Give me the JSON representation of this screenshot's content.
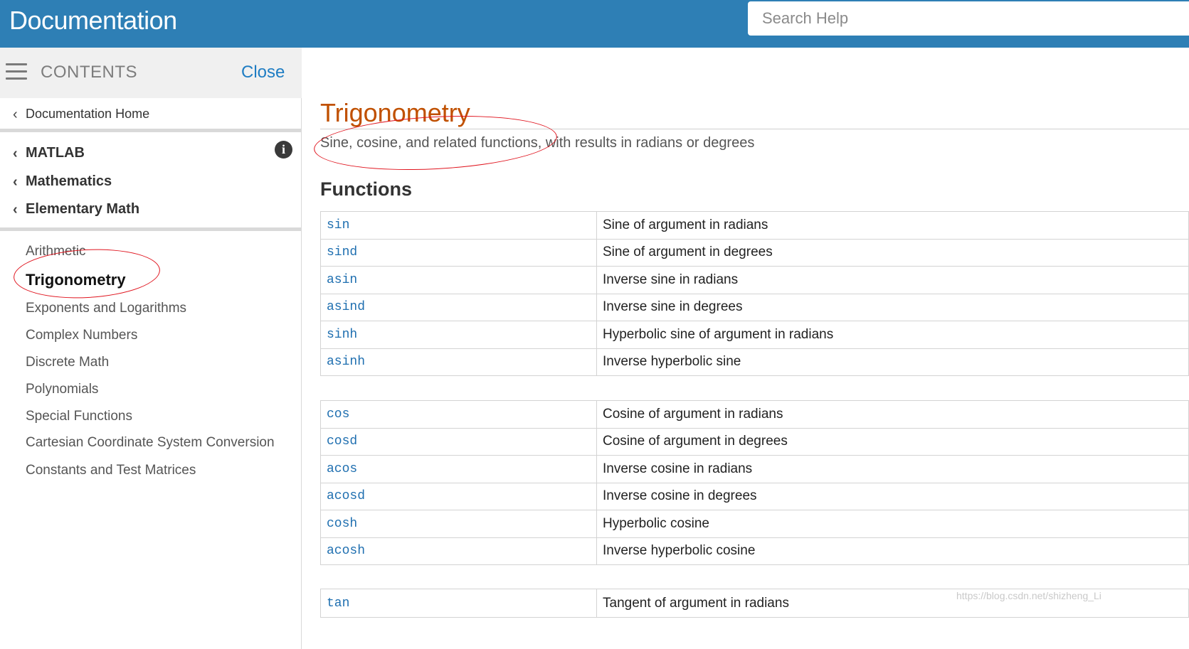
{
  "header": {
    "title": "Documentation",
    "search_placeholder": "Search Help"
  },
  "sidebar": {
    "contents_label": "CONTENTS",
    "close_label": "Close",
    "doc_home": "Documentation Home",
    "breadcrumbs": [
      "MATLAB",
      "Mathematics",
      "Elementary Math"
    ],
    "items": [
      {
        "label": "Arithmetic",
        "active": false
      },
      {
        "label": "Trigonometry",
        "active": true
      },
      {
        "label": "Exponents and Logarithms",
        "active": false
      },
      {
        "label": "Complex Numbers",
        "active": false
      },
      {
        "label": "Discrete Math",
        "active": false
      },
      {
        "label": "Polynomials",
        "active": false
      },
      {
        "label": "Special Functions",
        "active": false
      },
      {
        "label": "Cartesian Coordinate System Conversion",
        "active": false
      },
      {
        "label": "Constants and Test Matrices",
        "active": false
      }
    ]
  },
  "main": {
    "title": "Trigonometry",
    "subtitle": "Sine, cosine, and related functions, with results in radians or degrees",
    "functions_heading": "Functions",
    "tables": [
      [
        {
          "name": "sin",
          "desc": "Sine of argument in radians"
        },
        {
          "name": "sind",
          "desc": "Sine of argument in degrees"
        },
        {
          "name": "asin",
          "desc": "Inverse sine in radians"
        },
        {
          "name": "asind",
          "desc": "Inverse sine in degrees"
        },
        {
          "name": "sinh",
          "desc": "Hyperbolic sine of argument in radians"
        },
        {
          "name": "asinh",
          "desc": "Inverse hyperbolic sine"
        }
      ],
      [
        {
          "name": "cos",
          "desc": "Cosine of argument in radians"
        },
        {
          "name": "cosd",
          "desc": "Cosine of argument in degrees"
        },
        {
          "name": "acos",
          "desc": "Inverse cosine in radians"
        },
        {
          "name": "acosd",
          "desc": "Inverse cosine in degrees"
        },
        {
          "name": "cosh",
          "desc": "Hyperbolic cosine"
        },
        {
          "name": "acosh",
          "desc": "Inverse hyperbolic cosine"
        }
      ],
      [
        {
          "name": "tan",
          "desc": "Tangent of argument in radians"
        }
      ]
    ]
  },
  "watermark": "https://blog.csdn.net/shizheng_Li",
  "colors": {
    "header_bg": "#2e7fb5",
    "title": "#c05000",
    "link": "#1f6fb0",
    "annotation": "#e0141e"
  }
}
